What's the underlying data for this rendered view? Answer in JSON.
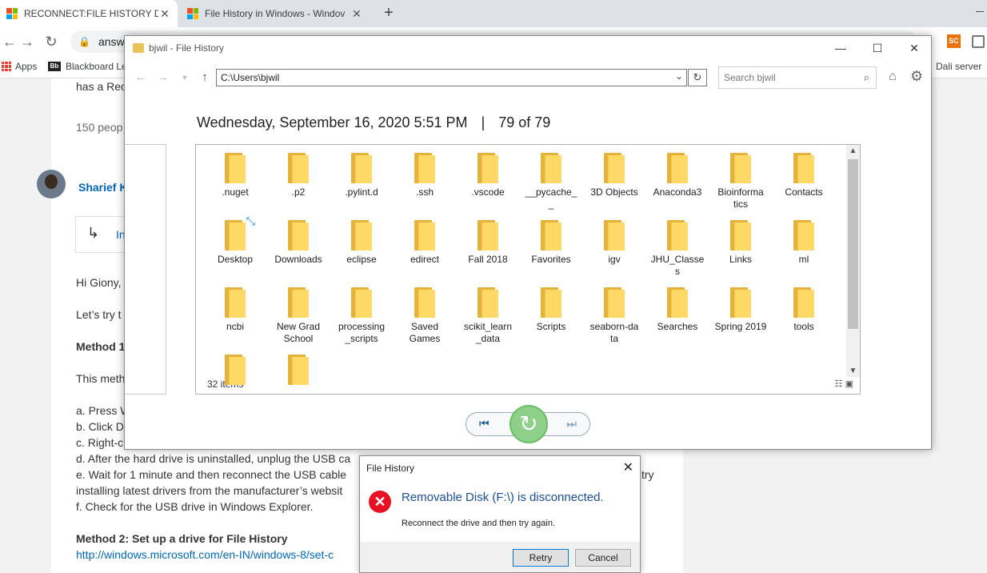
{
  "browser": {
    "tabs": [
      {
        "title": "RECONNECT:FILE HISTORY DRIVE"
      },
      {
        "title": "File History in Windows - Windov"
      }
    ],
    "address": "answe",
    "bookmarks": {
      "apps": "Apps",
      "blackboard": "Blackboard Le",
      "dali": "Dali server",
      "bb_badge": "Bb"
    },
    "ext_label": "SC"
  },
  "page": {
    "line_top": "has a Rec",
    "line_count": "150 peop",
    "user_name": "Sharief K",
    "quote_text": "In",
    "greeting": "Hi Giony,",
    "lets_try": "Let’s try t",
    "method1": "Method 1",
    "method_desc": "This meth",
    "step_a": "a. Press W",
    "step_b": "b. Click D",
    "step_c": "c. Right-c",
    "step_d": "d. After the hard drive is uninstalled, unplug the USB ca",
    "step_e": "e. Wait for 1 minute and then reconnect the USB cable",
    "step_e_tail": "try",
    "step_e2": "installing latest drivers from the manufacturer’s websit",
    "step_f": "f. Check for the USB drive in Windows Explorer.",
    "method2": "Method 2: Set up a drive for File History",
    "method2_link": "http://windows.microsoft.com/en-IN/windows-8/set-c"
  },
  "file_history": {
    "window_title": "bjwil - File History",
    "path": "C:\\Users\\bjwil",
    "search_placeholder": "Search bjwil",
    "date": "Wednesday, September 16, 2020 5:51 PM",
    "separator": "|",
    "position": "79 of 79",
    "items_count": "32 items",
    "folders": [
      [
        ".nuget"
      ],
      [
        ".p2"
      ],
      [
        ".pylint.d"
      ],
      [
        ".ssh"
      ],
      [
        ".vscode"
      ],
      [
        "__pycache_",
        "_"
      ],
      [
        "3D Objects"
      ],
      [
        "Anaconda3"
      ],
      [
        "Bioinforma",
        "tics"
      ],
      [
        "Contacts"
      ],
      [
        "Desktop"
      ],
      [
        "Downloads"
      ],
      [
        "eclipse"
      ],
      [
        "edirect"
      ],
      [
        "Fall 2018"
      ],
      [
        "Favorites"
      ],
      [
        "igv"
      ],
      [
        "JHU_Classe",
        "s"
      ],
      [
        "Links"
      ],
      [
        "ml"
      ],
      [
        "ncbi"
      ],
      [
        "New Grad",
        "School"
      ],
      [
        "processing",
        "_scripts"
      ],
      [
        "Saved",
        "Games"
      ],
      [
        "scikit_learn",
        "_data"
      ],
      [
        "Scripts"
      ],
      [
        "seaborn-da",
        "ta"
      ],
      [
        "Searches"
      ],
      [
        "Spring 2019"
      ],
      [
        "tools"
      ],
      [
        ""
      ],
      [
        ""
      ]
    ]
  },
  "dialog": {
    "title": "File History",
    "message": "Removable Disk (F:\\) is disconnected.",
    "detail": "Reconnect the drive and then try again.",
    "retry": "Retry",
    "cancel": "Cancel"
  }
}
